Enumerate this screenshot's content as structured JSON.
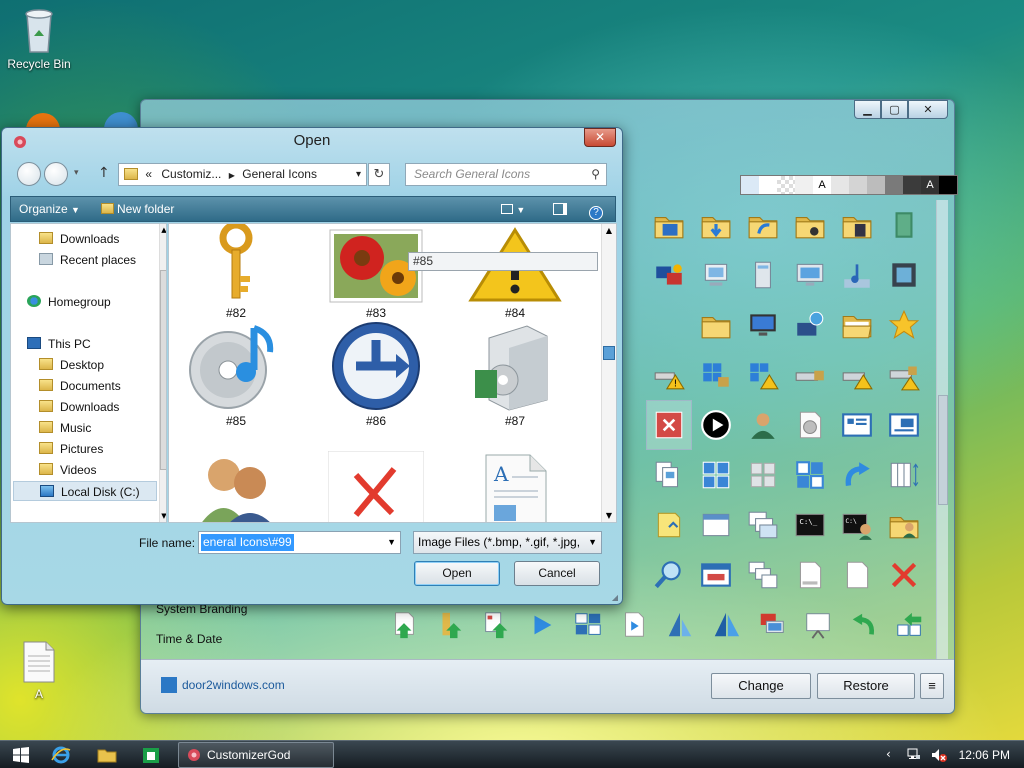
{
  "desktop": {
    "icons": [
      {
        "label": "Recycle Bin",
        "icon": "recycle-bin-icon"
      },
      {
        "label": "A",
        "icon": "text-document-icon"
      }
    ]
  },
  "customizer": {
    "window_buttons": [
      "minimize",
      "maximize",
      "close"
    ],
    "color_swatches": [
      "#dbe9f6",
      "#ffffff",
      "checker",
      "#f0f0f0",
      "A",
      "#e6e6e6",
      "#d4d4d4",
      "#bcbcbc",
      "#7a7a7a",
      "#3b3b3b",
      "A",
      "#000000"
    ],
    "sidebar_items": [
      "System Branding",
      "Time & Date"
    ],
    "link": "door2windows.com",
    "buttons": {
      "change": "Change",
      "restore": "Restore",
      "menu": "≡"
    },
    "icon_grid": [
      "folder-blue-icon",
      "folder-down-icon",
      "folder-arrow-icon",
      "folder-music-icon",
      "folder-video-icon",
      "book-icon",
      "network-color-icon",
      "computer-doc-icon",
      "computer-tower-icon",
      "monitor-icon",
      "music-note-icon",
      "film-icon",
      "blank",
      "folder-yellow-icon",
      "monitor-blue-icon",
      "network-globe-icon",
      "folder-open-icon",
      "star-icon",
      "lock-warning-icon",
      "windows-lock-icon",
      "windows-warning-icon",
      "drive-lock-icon",
      "drive-warning-icon",
      "drive-lock-warning-icon",
      "close-red-icon",
      "play-circle-icon",
      "user-icon",
      "cd-doc-icon",
      "window-list-icon",
      "window-bars-icon",
      "stacked-docs-icon",
      "grid-tiles-icon",
      "grid-gray-icon",
      "grid-blue-icon",
      "redo-arrow-icon",
      "columns-icon",
      "note-yellow-icon",
      "calendar-icon",
      "window-stack-icon",
      "cmd-icon",
      "cmd-admin-icon",
      "folder-user-icon",
      "magnifier-icon",
      "window-edit-icon",
      "stacked-windows-icon",
      "page-icon",
      "page-blank-icon",
      "red-x-icon"
    ],
    "bottom_icons": [
      "page-green-arrow-icon",
      "bookmark-green-arrow-icon",
      "list-green-arrow-icon",
      "blue-triangle-icon",
      "tiles-arrow-icon",
      "page-play-icon",
      "sail-icon",
      "sail-blue-icon",
      "monitor-red-icon",
      "projector-icon",
      "back-arrow-icon",
      "tiles-green-icon"
    ]
  },
  "dialog": {
    "title": "Open",
    "close": "✕",
    "address": {
      "prefix": "«",
      "parts": [
        "Customiz...",
        "General Icons"
      ]
    },
    "search_placeholder": "Search General Icons",
    "toolbar": {
      "organize": "Organize",
      "new_folder": "New folder"
    },
    "nav": [
      {
        "label": "Downloads",
        "indent": 1,
        "icon": "downloads-folder-icon"
      },
      {
        "label": "Recent places",
        "indent": 1,
        "icon": "recent-places-icon"
      },
      {
        "label": "Homegroup",
        "indent": 0,
        "icon": "homegroup-icon"
      },
      {
        "label": "This PC",
        "indent": 0,
        "icon": "computer-icon"
      },
      {
        "label": "Desktop",
        "indent": 1,
        "icon": "desktop-folder-icon"
      },
      {
        "label": "Documents",
        "indent": 1,
        "icon": "documents-folder-icon"
      },
      {
        "label": "Downloads",
        "indent": 1,
        "icon": "downloads-folder-icon"
      },
      {
        "label": "Music",
        "indent": 1,
        "icon": "music-folder-icon"
      },
      {
        "label": "Pictures",
        "indent": 1,
        "icon": "pictures-folder-icon"
      },
      {
        "label": "Videos",
        "indent": 1,
        "icon": "videos-folder-icon"
      },
      {
        "label": "Local Disk (C:)",
        "indent": 1,
        "icon": "local-disk-icon",
        "selected": true
      }
    ],
    "files": [
      {
        "caption": "#82",
        "icon": "key-icon"
      },
      {
        "caption": "#83",
        "icon": "flowers-photo-icon"
      },
      {
        "caption": "#84",
        "icon": "warning-triangle-icon"
      },
      {
        "caption": "#85",
        "icon": "cd-music-icon"
      },
      {
        "caption": "#86",
        "icon": "clock-arrow-icon"
      },
      {
        "caption": "#87",
        "icon": "software-box-icon"
      },
      {
        "caption": "",
        "icon": "users-icon"
      },
      {
        "caption": "",
        "icon": "red-x-icon"
      },
      {
        "caption": "",
        "icon": "document-icon"
      }
    ],
    "tooltip": "#85",
    "filename_label": "File name:",
    "filename_value": "eneral Icons\\#99",
    "filetype": "Image Files (*.bmp, *.gif, *.jpg,",
    "open_label": "Open",
    "cancel_label": "Cancel"
  },
  "taskbar": {
    "task_label": "CustomizerGod",
    "time": "12:06 PM",
    "pinned": [
      "windows-start-icon",
      "internet-explorer-icon",
      "file-explorer-icon",
      "store-icon"
    ]
  }
}
